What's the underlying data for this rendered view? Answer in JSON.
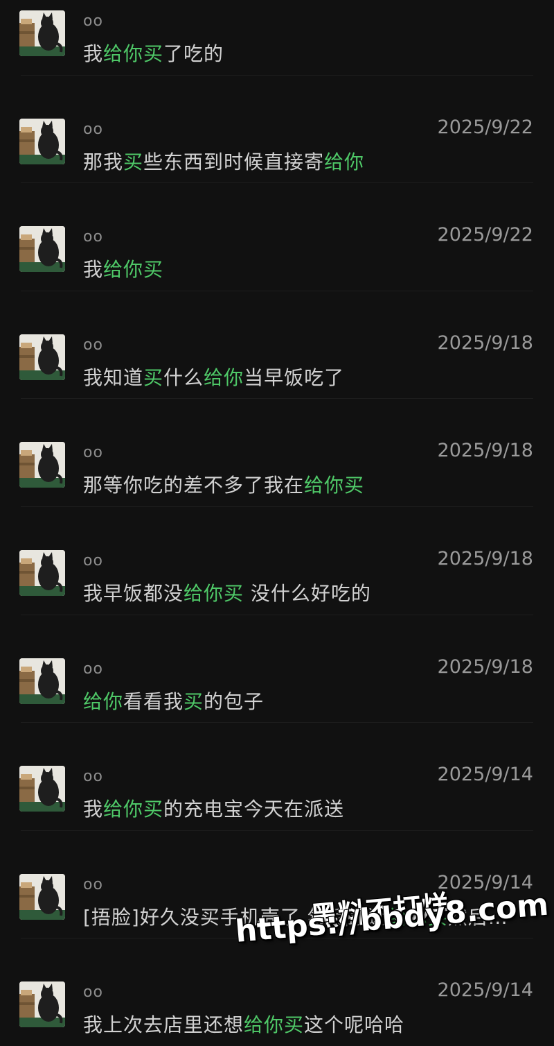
{
  "messages": [
    {
      "name": "oo",
      "date": "",
      "segments": [
        {
          "t": "我",
          "h": false
        },
        {
          "t": "给你买",
          "h": true
        },
        {
          "t": "了吃的",
          "h": false
        }
      ]
    },
    {
      "name": "oo",
      "date": "2025/9/22",
      "segments": [
        {
          "t": "那我",
          "h": false
        },
        {
          "t": "买",
          "h": true
        },
        {
          "t": "些东西到时候直接寄",
          "h": false
        },
        {
          "t": "给你",
          "h": true
        }
      ]
    },
    {
      "name": "oo",
      "date": "2025/9/22",
      "segments": [
        {
          "t": "我",
          "h": false
        },
        {
          "t": "给你买",
          "h": true
        }
      ]
    },
    {
      "name": "oo",
      "date": "2025/9/18",
      "segments": [
        {
          "t": "我知道",
          "h": false
        },
        {
          "t": "买",
          "h": true
        },
        {
          "t": "什么",
          "h": false
        },
        {
          "t": "给你",
          "h": true
        },
        {
          "t": "当早饭吃了",
          "h": false
        }
      ]
    },
    {
      "name": "oo",
      "date": "2025/9/18",
      "segments": [
        {
          "t": "那等你吃的差不多了我在",
          "h": false
        },
        {
          "t": "给你买",
          "h": true
        }
      ]
    },
    {
      "name": "oo",
      "date": "2025/9/18",
      "segments": [
        {
          "t": "我早饭都没",
          "h": false
        },
        {
          "t": "给你买",
          "h": true
        },
        {
          "t": " 没什么好吃的",
          "h": false
        }
      ]
    },
    {
      "name": "oo",
      "date": "2025/9/18",
      "segments": [
        {
          "t": "给你",
          "h": true
        },
        {
          "t": "看看我",
          "h": false
        },
        {
          "t": "买",
          "h": true
        },
        {
          "t": "的包子",
          "h": false
        }
      ]
    },
    {
      "name": "oo",
      "date": "2025/9/14",
      "segments": [
        {
          "t": "我",
          "h": false
        },
        {
          "t": "给你买",
          "h": true
        },
        {
          "t": "的充电宝今天在派送",
          "h": false
        }
      ]
    },
    {
      "name": "oo",
      "date": "2025/9/14",
      "segments": [
        {
          "t": "[捂脸]好久没买手机壳了 然后最近",
          "h": false
        },
        {
          "t": "给你买",
          "h": true
        },
        {
          "t": "然后…",
          "h": false
        }
      ]
    },
    {
      "name": "oo",
      "date": "2025/9/14",
      "segments": [
        {
          "t": "我上次去店里还想",
          "h": false
        },
        {
          "t": "给你买",
          "h": true
        },
        {
          "t": "这个呢哈哈",
          "h": false
        }
      ]
    }
  ],
  "watermark": {
    "line1": "黑料不打烊",
    "line2": "https://bbdy8.com"
  },
  "colors": {
    "background": "#111111",
    "highlight": "#4fc968",
    "text": "#d2d2d2",
    "meta": "#9a9a9a"
  },
  "icons": {
    "avatar": "black-cat-avatar-icon"
  }
}
